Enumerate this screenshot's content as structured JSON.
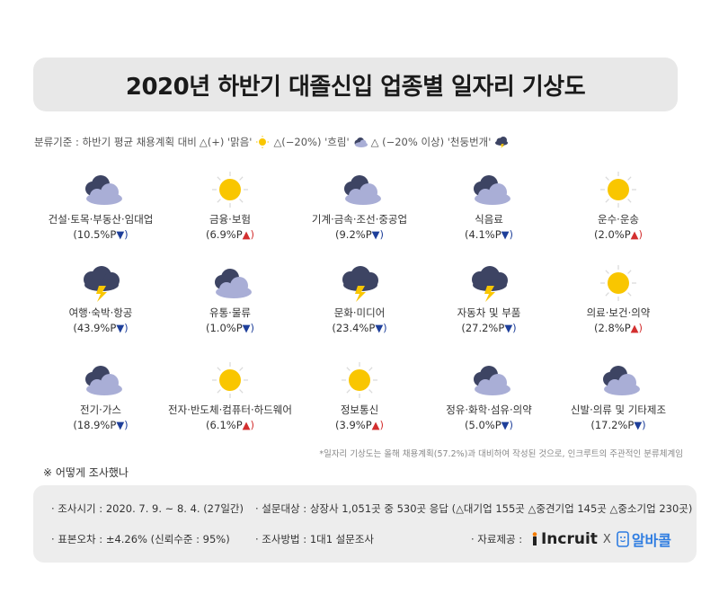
{
  "title": "2020년 하반기 대졸신입 업종별 일자리 기상도",
  "legend": {
    "prefix": "분류기준 : 하반기 평균 채용계획 대비",
    "sunny": "△(+) '맑음'",
    "cloudy": "△(−20%) '흐림'",
    "storm": "△ (−20% 이상) '천둥번개'"
  },
  "industries": [
    {
      "name": "건설·토목·부동산·임대업",
      "value": "(10.5%P",
      "dir": "down",
      "weather": "cloudy"
    },
    {
      "name": "금융·보험",
      "value": "(6.9%P",
      "dir": "up",
      "weather": "sunny"
    },
    {
      "name": "기계·금속·조선·중공업",
      "value": "(9.2%P",
      "dir": "down",
      "weather": "cloudy"
    },
    {
      "name": "식음료",
      "value": "(4.1%P",
      "dir": "down",
      "weather": "cloudy"
    },
    {
      "name": "운수·운송",
      "value": "(2.0%P",
      "dir": "up",
      "weather": "sunny"
    },
    {
      "name": "여행·숙박·항공",
      "value": "(43.9%P",
      "dir": "down",
      "weather": "storm"
    },
    {
      "name": "유통·물류",
      "value": "(1.0%P",
      "dir": "down",
      "weather": "cloudy"
    },
    {
      "name": "문화·미디어",
      "value": "(23.4%P",
      "dir": "down",
      "weather": "storm"
    },
    {
      "name": "자동차 및 부품",
      "value": "(27.2%P",
      "dir": "down",
      "weather": "storm"
    },
    {
      "name": "의료·보건·의약",
      "value": "(2.8%P",
      "dir": "up",
      "weather": "sunny"
    },
    {
      "name": "전기·가스",
      "value": "(18.9%P",
      "dir": "down",
      "weather": "cloudy"
    },
    {
      "name": "전자·반도체·컴퓨터·하드웨어",
      "value": "(6.1%P",
      "dir": "up",
      "weather": "sunny"
    },
    {
      "name": "정보통신",
      "value": "(3.9%P",
      "dir": "up",
      "weather": "sunny"
    },
    {
      "name": "정유·화학·섬유·의약",
      "value": "(5.0%P",
      "dir": "down",
      "weather": "cloudy"
    },
    {
      "name": "신발·의류 및 기타제조",
      "value": "(17.2%P",
      "dir": "down",
      "weather": "cloudy"
    }
  ],
  "arrows": {
    "up": "▲)",
    "down": "▼)"
  },
  "note": "*일자리 기상도는 올해 채용계획(57.2%)과 대비하여 작성된 것으로, 인크루트의 주관적인 분류체계임",
  "how_title": "※ 어떻게 조사했나",
  "survey": {
    "period": "· 조사시기 : 2020. 7. 9. ~ 8. 4. (27일간)",
    "target": "· 설문대상 : 상장사 1,051곳 중 530곳 응답 (△대기업 155곳 △중견기업 145곳 △중소기업 230곳)",
    "error": "· 표본오차 : ±4.26% (신뢰수준 : 95%)",
    "method": "· 조사방법 : 1대1 설문조사",
    "provider": "· 자료제공 :",
    "logo1": "Incruit",
    "x": "X",
    "logo2": "알바콜"
  },
  "colors": {
    "cloud": "#a9aed6",
    "cloud_dark": "#3d4463",
    "sun": "#f9c600",
    "up": "#d32f2f",
    "down": "#1e3f9a"
  }
}
